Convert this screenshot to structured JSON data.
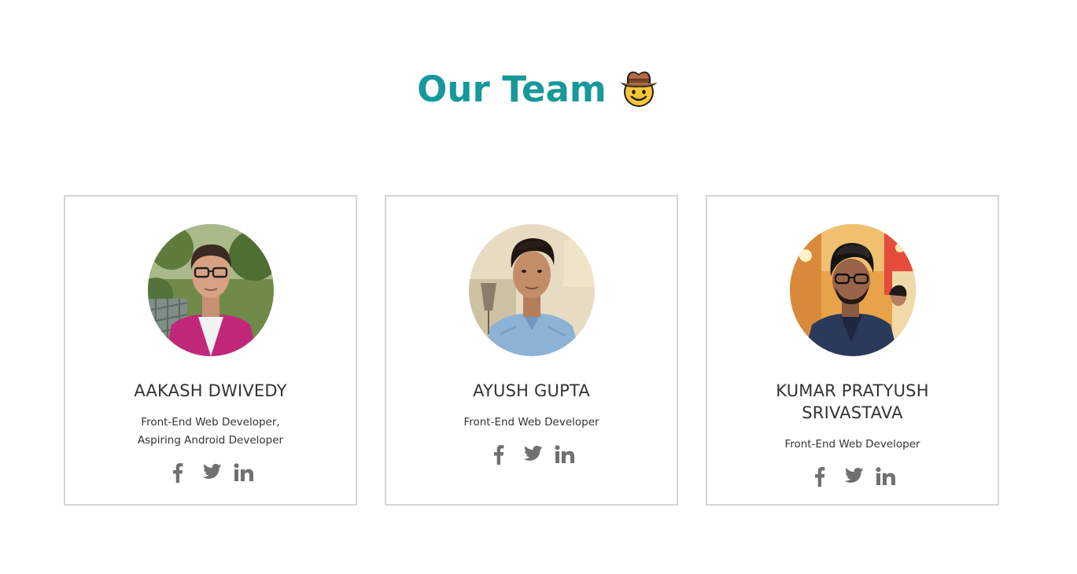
{
  "heading": {
    "title": "Our Team",
    "emoji_icon": "cowboy-hat-face-icon"
  },
  "colors": {
    "heading": "#17989a",
    "card_border": "#d6d6d6",
    "text": "#333333",
    "social_icon": "#707070"
  },
  "members": [
    {
      "name": "AAKASH DWIVEDY",
      "role_lines": [
        "Front-End Web Developer,",
        "Aspiring Android Developer"
      ],
      "socials": [
        "facebook-icon",
        "twitter-icon",
        "linkedin-icon"
      ]
    },
    {
      "name": "AYUSH GUPTA",
      "role_lines": [
        "Front-End Web Developer"
      ],
      "socials": [
        "facebook-icon",
        "twitter-icon",
        "linkedin-icon"
      ]
    },
    {
      "name": "KUMAR PRATYUSH SRIVASTAVA",
      "role_lines": [
        "Front-End Web Developer"
      ],
      "socials": [
        "facebook-icon",
        "twitter-icon",
        "linkedin-icon"
      ]
    }
  ]
}
